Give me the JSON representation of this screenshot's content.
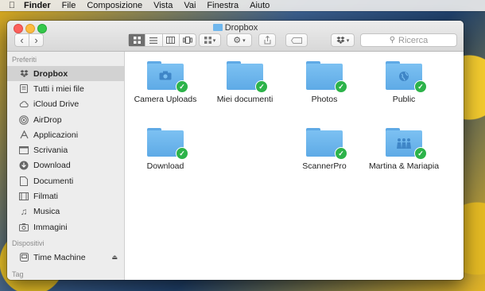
{
  "menubar": {
    "apple_icon": "apple-logo",
    "items": [
      "Finder",
      "File",
      "Composizione",
      "Vista",
      "Vai",
      "Finestra",
      "Aiuto"
    ]
  },
  "window": {
    "title": "Dropbox",
    "title_icon": "dropbox-folder-icon"
  },
  "toolbar": {
    "back_icon": "‹",
    "forward_icon": "›",
    "search_placeholder": "Ricerca",
    "view_modes": [
      "icon-view",
      "list-view",
      "column-view",
      "coverflow-view"
    ],
    "active_view": "icon-view"
  },
  "sidebar": {
    "favorites_title": "Preferiti",
    "favorites": [
      {
        "label": "Dropbox",
        "icon": "dropbox-icon",
        "selected": true
      },
      {
        "label": "Tutti i miei file",
        "icon": "all-files-icon"
      },
      {
        "label": "iCloud Drive",
        "icon": "cloud-icon"
      },
      {
        "label": "AirDrop",
        "icon": "airdrop-icon"
      },
      {
        "label": "Applicazioni",
        "icon": "applications-icon"
      },
      {
        "label": "Scrivania",
        "icon": "desktop-icon"
      },
      {
        "label": "Download",
        "icon": "download-icon"
      },
      {
        "label": "Documenti",
        "icon": "documents-icon"
      },
      {
        "label": "Filmati",
        "icon": "movies-icon"
      },
      {
        "label": "Musica",
        "icon": "music-icon"
      },
      {
        "label": "Immagini",
        "icon": "pictures-icon"
      }
    ],
    "devices_title": "Dispositivi",
    "devices": [
      {
        "label": "Time Machine",
        "icon": "time-machine-icon"
      }
    ],
    "tags_title": "Tag"
  },
  "items": [
    {
      "label": "Camera Uploads",
      "glyph": "camera-icon",
      "synced": true
    },
    {
      "label": "Miei documenti",
      "glyph": "",
      "synced": true
    },
    {
      "label": "Photos",
      "glyph": "",
      "synced": true
    },
    {
      "label": "Public",
      "glyph": "globe-icon",
      "synced": true
    },
    {
      "label": "Download",
      "glyph": "",
      "synced": true
    },
    {
      "label": "ScannerPro",
      "glyph": "",
      "synced": true
    },
    {
      "label": "Martina & Mariapia",
      "glyph": "shared-people-icon",
      "synced": true
    }
  ],
  "colors": {
    "folder": "#6fb6ec",
    "sync_check": "#2db34a",
    "sidebar_bg": "#ededed",
    "selected_row": "#d2d2d2"
  }
}
